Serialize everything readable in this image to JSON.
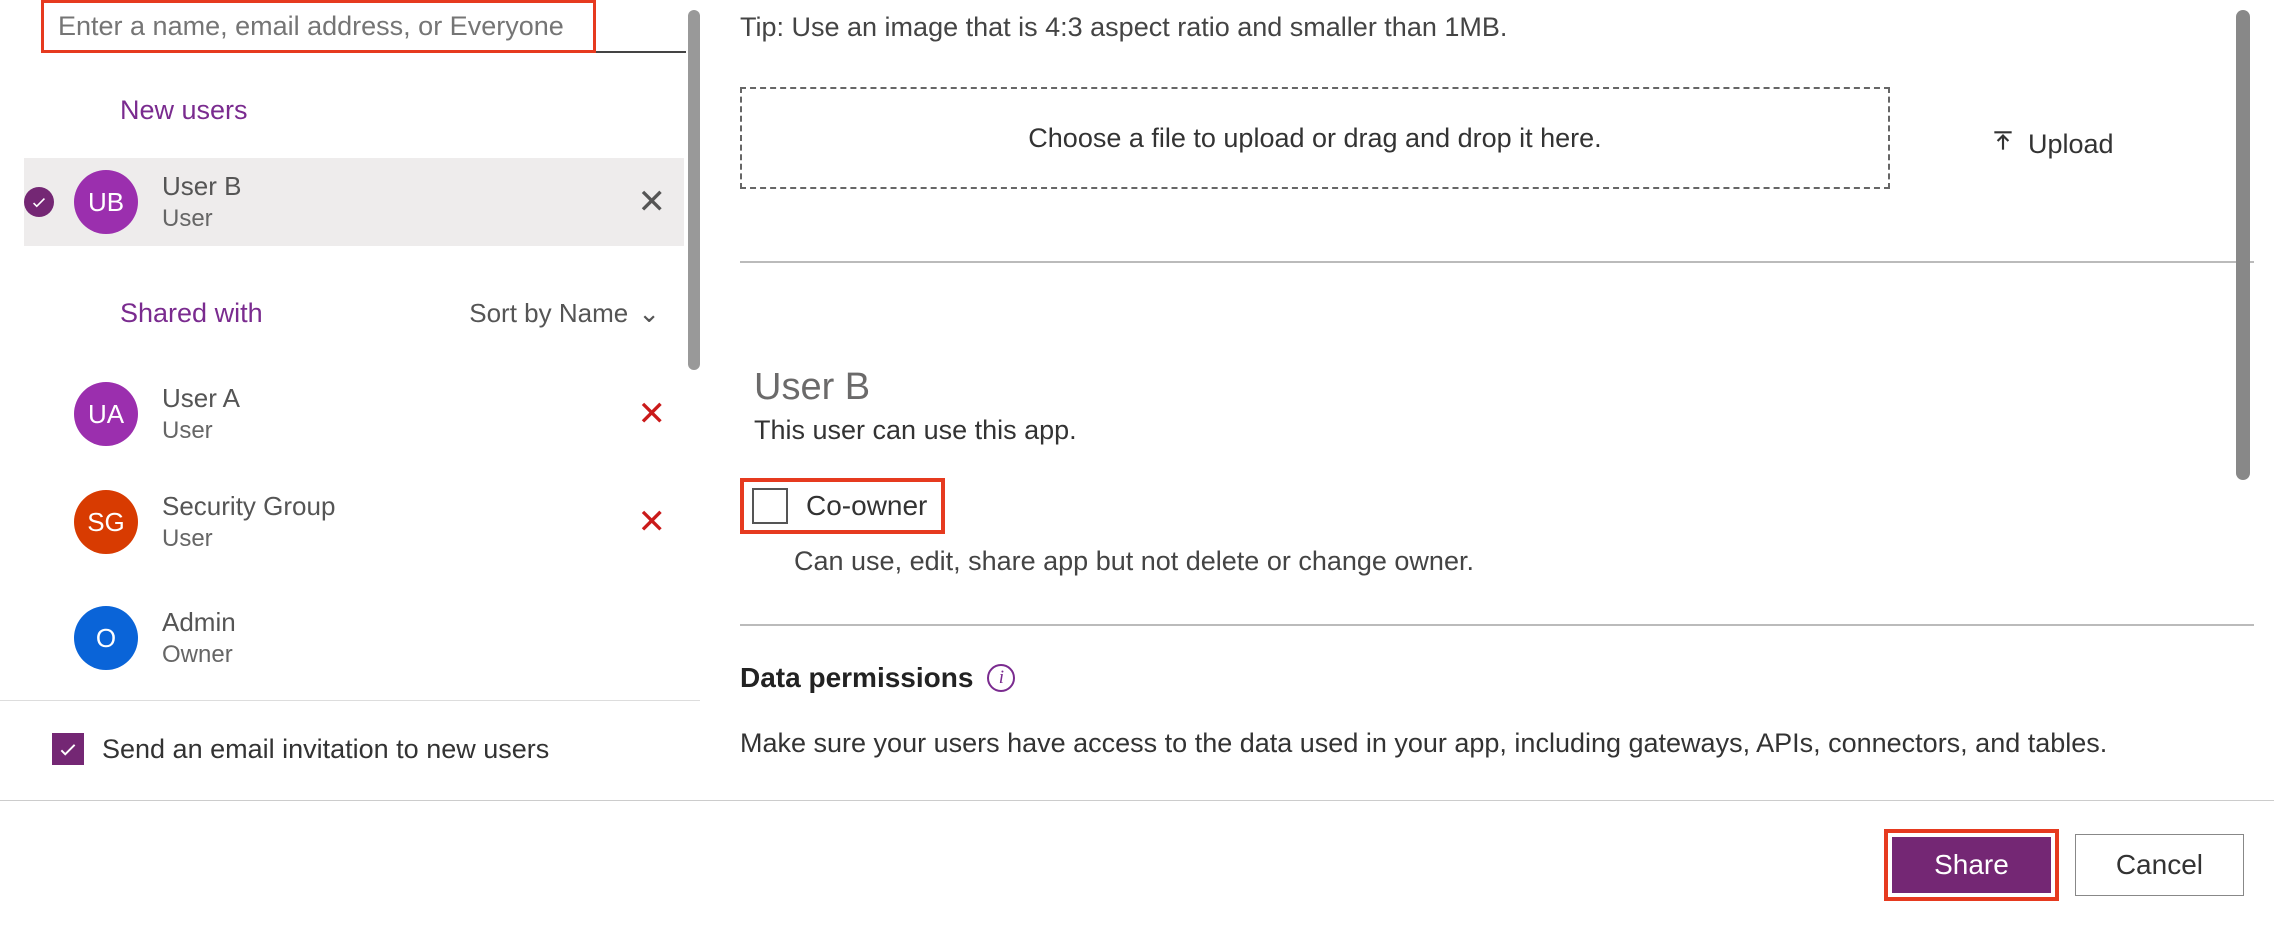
{
  "colors": {
    "accent": "#742774",
    "highlight": "#e63a1f",
    "avatar_purple": "#9b2fae",
    "avatar_red": "#d83b01",
    "avatar_blue": "#0a64d8"
  },
  "left": {
    "search_placeholder": "Enter a name, email address, or Everyone",
    "new_users_label": "New users",
    "selected_user": {
      "initials": "UB",
      "name": "User B",
      "role": "User"
    },
    "shared_with_label": "Shared with",
    "sort_label": "Sort by Name",
    "shared_users": [
      {
        "initials": "UA",
        "name": "User A",
        "role": "User",
        "avatar_color": "#9b2fae",
        "removable": true
      },
      {
        "initials": "SG",
        "name": "Security Group",
        "role": "User",
        "avatar_color": "#d83b01",
        "removable": true
      },
      {
        "initials": "O",
        "name": "Admin",
        "role": "Owner",
        "avatar_color": "#0a64d8",
        "removable": false
      }
    ],
    "send_email_label": "Send an email invitation to new users",
    "send_email_checked": true
  },
  "right": {
    "tip_text": "Tip: Use an image that is 4:3 aspect ratio and smaller than 1MB.",
    "dropzone_text": "Choose a file to upload or drag and drop it here.",
    "upload_label": "Upload",
    "detail_user_name": "User B",
    "detail_user_desc": "This user can use this app.",
    "coowner_label": "Co-owner",
    "coowner_desc": "Can use, edit, share app but not delete or change owner.",
    "coowner_checked": false,
    "data_permissions_label": "Data permissions",
    "data_permissions_desc": "Make sure your users have access to the data used in your app, including gateways, APIs, connectors, and tables."
  },
  "footer": {
    "share_label": "Share",
    "cancel_label": "Cancel"
  }
}
